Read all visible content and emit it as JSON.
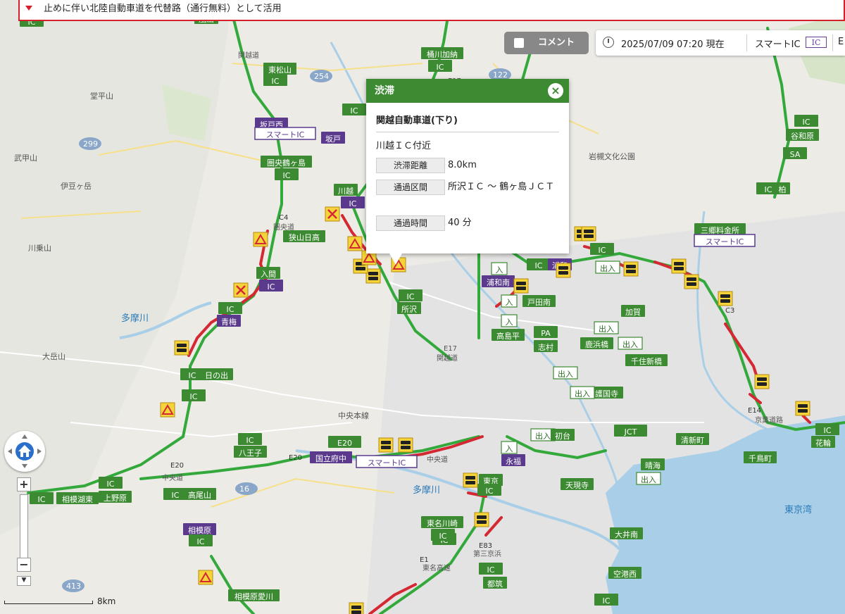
{
  "notice": {
    "text": "止めに伴い北陸自動車道を代替路（通行無料）として活用"
  },
  "comment_toggle": {
    "label": "コメント"
  },
  "status": {
    "timestamp": "2025/07/09 07:20 現在",
    "smart_ic_label": "スマートIC",
    "ic_badge": "IC",
    "more": "E"
  },
  "popup": {
    "title": "渋滞",
    "close": "×",
    "road": "関越自動車道(下り)",
    "location": "川越ＩＣ付近",
    "rows": [
      {
        "key": "渋滞距離",
        "value": "8.0km"
      },
      {
        "key": "通過区間",
        "value": "所沢ＩＣ 〜 鶴ヶ島ＪＣＴ"
      },
      {
        "key": "通過時間",
        "value": "40 分"
      }
    ]
  },
  "scale": {
    "label": "8km"
  },
  "colors": {
    "expressway": "#33a83b",
    "congestion": "#d42832",
    "sign_green": "#3c8a31",
    "sign_purple": "#5b3a8e",
    "water": "#a9cfe8",
    "notice_border": "#d4202a"
  },
  "icons": {
    "congestion": "car-jam-icon",
    "warning": "warning-triangle-icon",
    "closure": "closure-x-icon",
    "home": "home-icon"
  },
  "map_labels": [
    {
      "text": "堂平山"
    },
    {
      "text": "武甲山"
    },
    {
      "text": "伊豆ヶ岳"
    },
    {
      "text": "川乗山"
    },
    {
      "text": "大岳山"
    },
    {
      "text": "多摩川"
    },
    {
      "text": "多摩川"
    },
    {
      "text": "東京湾"
    },
    {
      "text": "中央本線"
    },
    {
      "text": "関越道"
    },
    {
      "text": "関越道"
    },
    {
      "text": "圏央道"
    },
    {
      "text": "中央道"
    },
    {
      "text": "中央道"
    },
    {
      "text": "東名高速"
    },
    {
      "text": "京葉道路"
    },
    {
      "text": "第三京浜"
    },
    {
      "text": "岩槻文化公園"
    },
    {
      "text": "254"
    },
    {
      "text": "122"
    },
    {
      "text": "299"
    },
    {
      "text": "16"
    },
    {
      "text": "413"
    },
    {
      "text": "E17"
    },
    {
      "text": "E17"
    },
    {
      "text": "C4"
    },
    {
      "text": "E20"
    },
    {
      "text": "E20"
    },
    {
      "text": "E1"
    },
    {
      "text": "E83"
    },
    {
      "text": "C3"
    },
    {
      "text": "E14"
    }
  ],
  "signs": [
    {
      "text": "IC"
    },
    {
      "text": "東松山"
    },
    {
      "text": "IC"
    },
    {
      "text": "嵐山"
    },
    {
      "text": "桶川加納"
    },
    {
      "text": "IC"
    },
    {
      "text": "坂戸西"
    },
    {
      "text": "スマートIC"
    },
    {
      "text": "IC"
    },
    {
      "text": "坂戸"
    },
    {
      "text": "圏央鶴ヶ島"
    },
    {
      "text": "IC"
    },
    {
      "text": "川越"
    },
    {
      "text": "IC"
    },
    {
      "text": "狭山日高"
    },
    {
      "text": "入間"
    },
    {
      "text": "IC"
    },
    {
      "text": "青梅"
    },
    {
      "text": "IC"
    },
    {
      "text": "IC"
    },
    {
      "text": "日の出"
    },
    {
      "text": "IC"
    },
    {
      "text": "所沢"
    },
    {
      "text": "IC"
    },
    {
      "text": "浦和北"
    },
    {
      "text": "入"
    },
    {
      "text": "IC"
    },
    {
      "text": "浦和"
    },
    {
      "text": "浦和南"
    },
    {
      "text": "入"
    },
    {
      "text": "戸田南"
    },
    {
      "text": "入"
    },
    {
      "text": "高島平"
    },
    {
      "text": "PA"
    },
    {
      "text": "志村"
    },
    {
      "text": "IC"
    },
    {
      "text": "谷和原"
    },
    {
      "text": "SA"
    },
    {
      "text": "IC"
    },
    {
      "text": "柏"
    },
    {
      "text": "三郷料金所"
    },
    {
      "text": "スマートIC"
    },
    {
      "text": "IC"
    },
    {
      "text": "出入"
    },
    {
      "text": "加賀"
    },
    {
      "text": "出入"
    },
    {
      "text": "鹿浜橋"
    },
    {
      "text": "出入"
    },
    {
      "text": "千住新橋"
    },
    {
      "text": "出入"
    },
    {
      "text": "護国寺"
    },
    {
      "text": "出入"
    },
    {
      "text": "IC"
    },
    {
      "text": "八王子"
    },
    {
      "text": "E20"
    },
    {
      "text": "国立府中"
    },
    {
      "text": "スマートIC"
    },
    {
      "text": "入"
    },
    {
      "text": "永福"
    },
    {
      "text": "出入"
    },
    {
      "text": "初台"
    },
    {
      "text": "JCT"
    },
    {
      "text": "清新町"
    },
    {
      "text": "IC"
    },
    {
      "text": "花輪"
    },
    {
      "text": "千鳥町"
    },
    {
      "text": "晴海"
    },
    {
      "text": "出入"
    },
    {
      "text": "天現寺"
    },
    {
      "text": "IC"
    },
    {
      "text": "相模湖東"
    },
    {
      "text": "IC"
    },
    {
      "text": "上野原"
    },
    {
      "text": "IC"
    },
    {
      "text": "高尾山"
    },
    {
      "text": "相模原"
    },
    {
      "text": "IC"
    },
    {
      "text": "IC"
    },
    {
      "text": "東名川崎"
    },
    {
      "text": "IC"
    },
    {
      "text": "大井南"
    },
    {
      "text": "空港西"
    },
    {
      "text": "IC"
    },
    {
      "text": "都筑"
    },
    {
      "text": "相模原愛川"
    },
    {
      "text": "東京"
    },
    {
      "text": "IC"
    },
    {
      "text": "IC"
    }
  ]
}
